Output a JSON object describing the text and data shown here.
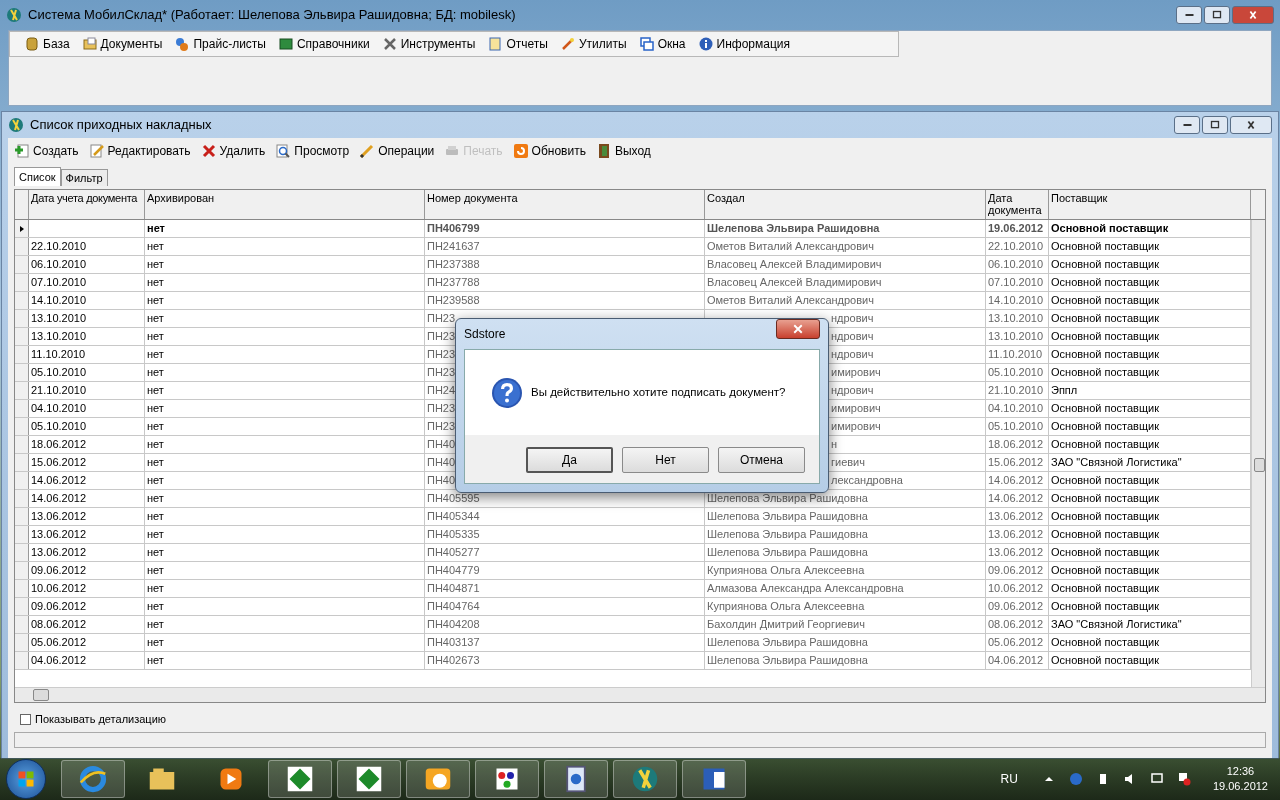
{
  "window": {
    "title": "Система МобилСклад* (Работает: Шелепова Эльвира Рашидовна; БД: mobilesk)"
  },
  "menu": [
    "База",
    "Документы",
    "Прайс-листы",
    "Справочники",
    "Инструменты",
    "Отчеты",
    "Утилиты",
    "Окна",
    "Информация"
  ],
  "child_window": {
    "title": "Список приходных накладных"
  },
  "toolbar": [
    {
      "label": "Создать",
      "disabled": false
    },
    {
      "label": "Редактировать",
      "disabled": false
    },
    {
      "label": "Удалить",
      "disabled": false
    },
    {
      "label": "Просмотр",
      "disabled": false
    },
    {
      "label": "Операции",
      "disabled": false
    },
    {
      "label": "Печать",
      "disabled": true
    },
    {
      "label": "Обновить",
      "disabled": false
    },
    {
      "label": "Выход",
      "disabled": false
    }
  ],
  "tabs": [
    {
      "label": "Список",
      "selected": true
    },
    {
      "label": "Фильтр",
      "selected": false
    }
  ],
  "table": {
    "columns": [
      "Дата учета документа",
      "Архивирован",
      "Номер документа",
      "Создал",
      "Дата документа",
      "Поставщик"
    ],
    "rows": [
      {
        "selected": true,
        "covered": false,
        "date": "",
        "archived": "нет",
        "number": "ПН406799",
        "creator": "Шелепова Эльвира Рашидовна",
        "doc_date": "19.06.2012",
        "supplier": "Основной поставщик"
      },
      {
        "selected": false,
        "covered": false,
        "date": "22.10.2010",
        "archived": "нет",
        "number": "ПН241637",
        "creator": "Ометов Виталий Александрович",
        "doc_date": "22.10.2010",
        "supplier": "Основной поставщик"
      },
      {
        "selected": false,
        "covered": false,
        "date": "06.10.2010",
        "archived": "нет",
        "number": "ПН237388",
        "creator": "Власовец Алексей Владимирович",
        "doc_date": "06.10.2010",
        "supplier": "Основной поставщик"
      },
      {
        "selected": false,
        "covered": false,
        "date": "07.10.2010",
        "archived": "нет",
        "number": "ПН237788",
        "creator": "Власовец Алексей Владимирович",
        "doc_date": "07.10.2010",
        "supplier": "Основной поставщик"
      },
      {
        "selected": false,
        "covered": false,
        "date": "14.10.2010",
        "archived": "нет",
        "number": "ПН239588",
        "creator": "Ометов Виталий Александрович",
        "doc_date": "14.10.2010",
        "supplier": "Основной поставщик"
      },
      {
        "selected": false,
        "covered": true,
        "date": "13.10.2010",
        "archived": "нет",
        "number": "ПН23",
        "creator": "ндрович",
        "doc_date": "13.10.2010",
        "supplier": "Основной поставщик"
      },
      {
        "selected": false,
        "covered": true,
        "date": "13.10.2010",
        "archived": "нет",
        "number": "ПН23",
        "creator": "ндрович",
        "doc_date": "13.10.2010",
        "supplier": "Основной поставщик"
      },
      {
        "selected": false,
        "covered": true,
        "date": "11.10.2010",
        "archived": "нет",
        "number": "ПН23",
        "creator": "ндрович",
        "doc_date": "11.10.2010",
        "supplier": "Основной поставщик"
      },
      {
        "selected": false,
        "covered": true,
        "date": "05.10.2010",
        "archived": "нет",
        "number": "ПН23",
        "creator": "имирович",
        "doc_date": "05.10.2010",
        "supplier": "Основной поставщик"
      },
      {
        "selected": false,
        "covered": true,
        "date": "21.10.2010",
        "archived": "нет",
        "number": "ПН24",
        "creator": "ндрович",
        "doc_date": "21.10.2010",
        "supplier": "Эппл"
      },
      {
        "selected": false,
        "covered": true,
        "date": "04.10.2010",
        "archived": "нет",
        "number": "ПН23",
        "creator": "имирович",
        "doc_date": "04.10.2010",
        "supplier": "Основной поставщик"
      },
      {
        "selected": false,
        "covered": true,
        "date": "05.10.2010",
        "archived": "нет",
        "number": "ПН23",
        "creator": "имирович",
        "doc_date": "05.10.2010",
        "supplier": "Основной поставщик"
      },
      {
        "selected": false,
        "covered": true,
        "date": "18.06.2012",
        "archived": "нет",
        "number": "ПН40",
        "creator": "н",
        "doc_date": "18.06.2012",
        "supplier": "Основной поставщик"
      },
      {
        "selected": false,
        "covered": true,
        "date": "15.06.2012",
        "archived": "нет",
        "number": "ПН40",
        "creator": "гиевич",
        "doc_date": "15.06.2012",
        "supplier": "ЗАО \"Связной Логистика\""
      },
      {
        "selected": false,
        "covered": true,
        "date": "14.06.2012",
        "archived": "нет",
        "number": "ПН40",
        "creator": "лександровна",
        "doc_date": "14.06.2012",
        "supplier": "Основной поставщик"
      },
      {
        "selected": false,
        "covered": false,
        "date": "14.06.2012",
        "archived": "нет",
        "number": "ПН405595",
        "creator": "Шелепова Эльвира Рашидовна",
        "doc_date": "14.06.2012",
        "supplier": "Основной поставщик"
      },
      {
        "selected": false,
        "covered": false,
        "date": "13.06.2012",
        "archived": "нет",
        "number": "ПН405344",
        "creator": "Шелепова Эльвира Рашидовна",
        "doc_date": "13.06.2012",
        "supplier": "Основной поставщик"
      },
      {
        "selected": false,
        "covered": false,
        "date": "13.06.2012",
        "archived": "нет",
        "number": "ПН405335",
        "creator": "Шелепова Эльвира Рашидовна",
        "doc_date": "13.06.2012",
        "supplier": "Основной поставщик"
      },
      {
        "selected": false,
        "covered": false,
        "date": "13.06.2012",
        "archived": "нет",
        "number": "ПН405277",
        "creator": "Шелепова Эльвира Рашидовна",
        "doc_date": "13.06.2012",
        "supplier": "Основной поставщик"
      },
      {
        "selected": false,
        "covered": false,
        "date": "09.06.2012",
        "archived": "нет",
        "number": "ПН404779",
        "creator": "Куприянова Ольга Алексеевна",
        "doc_date": "09.06.2012",
        "supplier": "Основной поставщик"
      },
      {
        "selected": false,
        "covered": false,
        "date": "10.06.2012",
        "archived": "нет",
        "number": "ПН404871",
        "creator": "Алмазова Александра Александровна",
        "doc_date": "10.06.2012",
        "supplier": "Основной поставщик"
      },
      {
        "selected": false,
        "covered": false,
        "date": "09.06.2012",
        "archived": "нет",
        "number": "ПН404764",
        "creator": "Куприянова Ольга Алексеевна",
        "doc_date": "09.06.2012",
        "supplier": "Основной поставщик"
      },
      {
        "selected": false,
        "covered": false,
        "date": "08.06.2012",
        "archived": "нет",
        "number": "ПН404208",
        "creator": "Бахолдин Дмитрий Георгиевич",
        "doc_date": "08.06.2012",
        "supplier": "ЗАО \"Связной Логистика\""
      },
      {
        "selected": false,
        "covered": false,
        "date": "05.06.2012",
        "archived": "нет",
        "number": "ПН403137",
        "creator": "Шелепова Эльвира Рашидовна",
        "doc_date": "05.06.2012",
        "supplier": "Основной поставщик"
      },
      {
        "selected": false,
        "covered": false,
        "date": "04.06.2012",
        "archived": "нет",
        "number": "ПН402673",
        "creator": "Шелепова Эльвира Рашидовна",
        "doc_date": "04.06.2012",
        "supplier": "Основной поставщик"
      }
    ]
  },
  "detail_checkbox": {
    "label": "Показывать детализацию",
    "checked": false
  },
  "dialog": {
    "title": "Sdstore",
    "message": "Вы действительно хотите подписать документ?",
    "buttons": [
      {
        "label": "Да",
        "selected": true
      },
      {
        "label": "Нет",
        "selected": false
      },
      {
        "label": "Отмена",
        "selected": false
      }
    ]
  },
  "taskbar": {
    "language": "RU",
    "time": "12:36",
    "date": "19.06.2012"
  }
}
